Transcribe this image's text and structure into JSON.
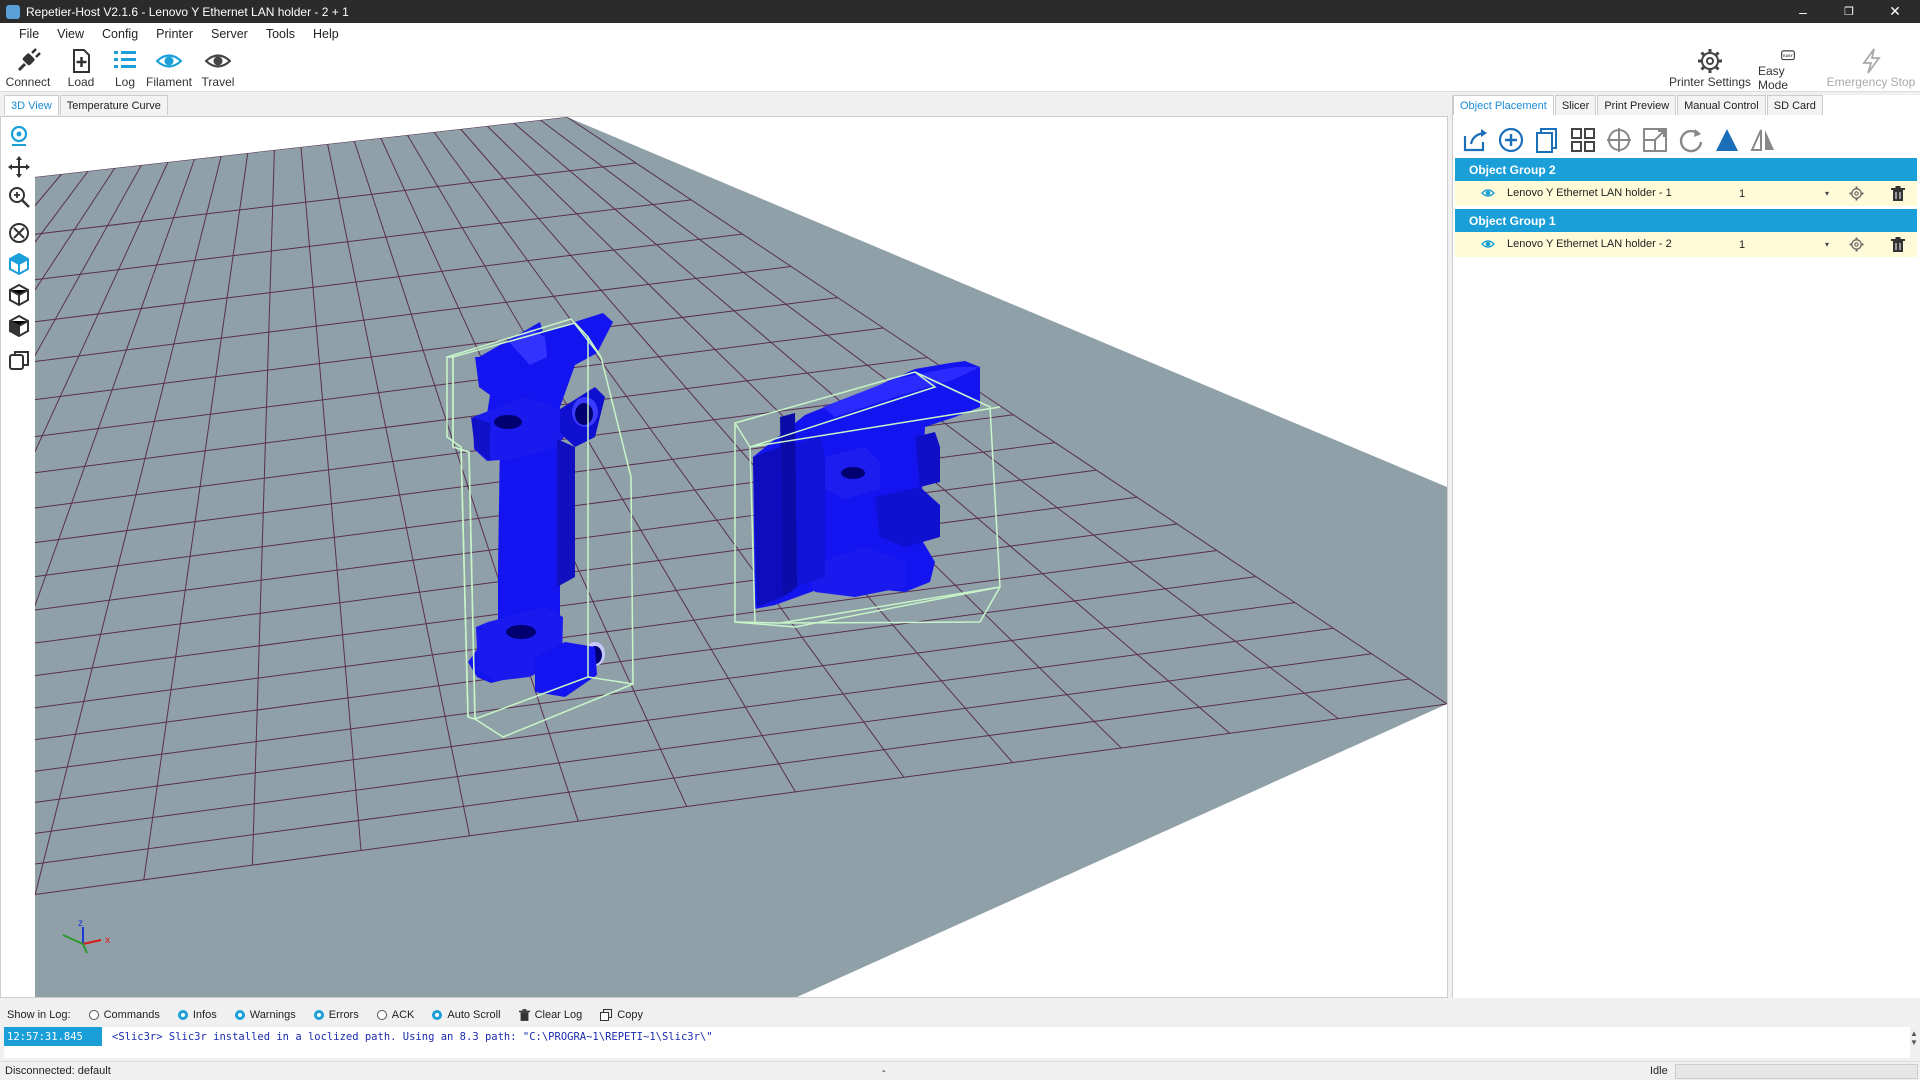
{
  "window": {
    "title": "Repetier-Host V2.1.6 - Lenovo Y Ethernet LAN holder - 2 + 1",
    "minimize": "–",
    "restore": "❐",
    "close": "✕"
  },
  "menu": [
    "File",
    "View",
    "Config",
    "Printer",
    "Server",
    "Tools",
    "Help"
  ],
  "toolbar": {
    "connect": "Connect",
    "load": "Load",
    "log": "Log",
    "filament": "Filament",
    "travel": "Travel",
    "printer_settings": "Printer Settings",
    "easy_mode": "Easy Mode",
    "emergency_stop": "Emergency Stop"
  },
  "view_tabs": [
    "3D View",
    "Temperature Curve"
  ],
  "right_tabs": [
    "Object Placement",
    "Slicer",
    "Print Preview",
    "Manual Control",
    "SD Card"
  ],
  "object_groups": [
    {
      "name": "Object Group 2",
      "object": "Lenovo Y Ethernet LAN holder - 1",
      "copies": "1"
    },
    {
      "name": "Object Group 1",
      "object": "Lenovo Y Ethernet LAN holder - 2",
      "copies": "1"
    }
  ],
  "axes": {
    "z": "z",
    "y": "y",
    "x": "x"
  },
  "log": {
    "show_in_log": "Show in Log:",
    "commands": "Commands",
    "infos": "Infos",
    "warnings": "Warnings",
    "errors": "Errors",
    "ack": "ACK",
    "auto_scroll": "Auto Scroll",
    "clear_log": "Clear Log",
    "copy": "Copy",
    "timestamp": "12:57:31.845",
    "message": "<Slic3r> Slic3r installed in a loclized path. Using an 8.3 path: \"C:\\PROGRA~1\\REPETI~1\\Slic3r\\\""
  },
  "status": {
    "connection": "Disconnected: default",
    "middle": "-",
    "state": "Idle"
  },
  "colors": {
    "accent": "#1a9fd8",
    "model": "#1414f0",
    "bed": "#8fa0a8",
    "grid": "#5a2f4d",
    "bbox": "#c8f5c8",
    "row_bg": "#fffbd9"
  }
}
